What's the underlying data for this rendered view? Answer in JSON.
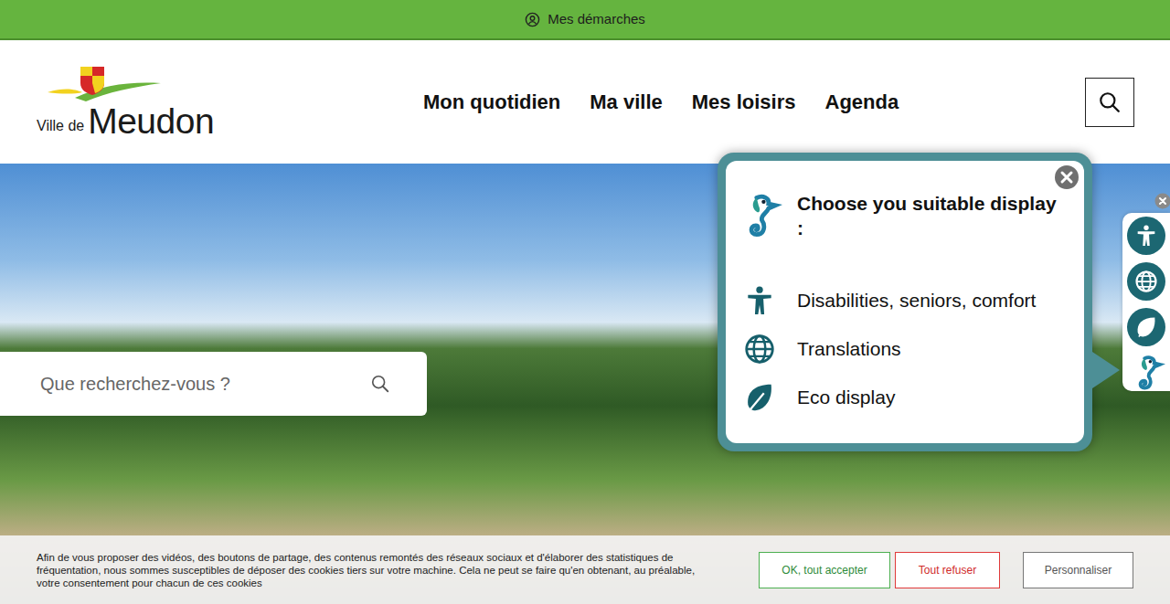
{
  "top_bar": {
    "link": "Mes démarches"
  },
  "logo": {
    "prefix": "Ville de",
    "name": "Meudon"
  },
  "nav": [
    {
      "label": "Mon quotidien"
    },
    {
      "label": "Ma ville"
    },
    {
      "label": "Mes loisirs"
    },
    {
      "label": "Agenda"
    }
  ],
  "hero": {
    "search": {
      "placeholder": "Que recherchez-vous ?"
    }
  },
  "display_panel": {
    "title": "Choose you suitable display :",
    "options": [
      {
        "label": "Disabilities, seniors, comfort",
        "kind": "accessibility"
      },
      {
        "label": "Translations",
        "kind": "translation"
      },
      {
        "label": "Eco display",
        "kind": "eco"
      }
    ]
  },
  "side_tools": [
    {
      "kind": "accessibility"
    },
    {
      "kind": "translation"
    },
    {
      "kind": "eco"
    },
    {
      "kind": "assistant"
    }
  ],
  "cookie_banner": {
    "text": "Afin de vous proposer des vidéos, des boutons de partage, des contenus remontés des réseaux sociaux et d'élaborer des statistiques de fréquentation, nous sommes susceptibles de déposer des cookies tiers sur votre machine. Cela ne peut se faire qu'en obtenant, au préalable, votre consentement pour chacun de ces cookies",
    "buttons": [
      {
        "label": "OK, tout accepter",
        "kind": "accept"
      },
      {
        "label": "Tout refuser",
        "kind": "refuse"
      },
      {
        "label": "Personnaliser",
        "kind": "custom"
      }
    ]
  }
}
